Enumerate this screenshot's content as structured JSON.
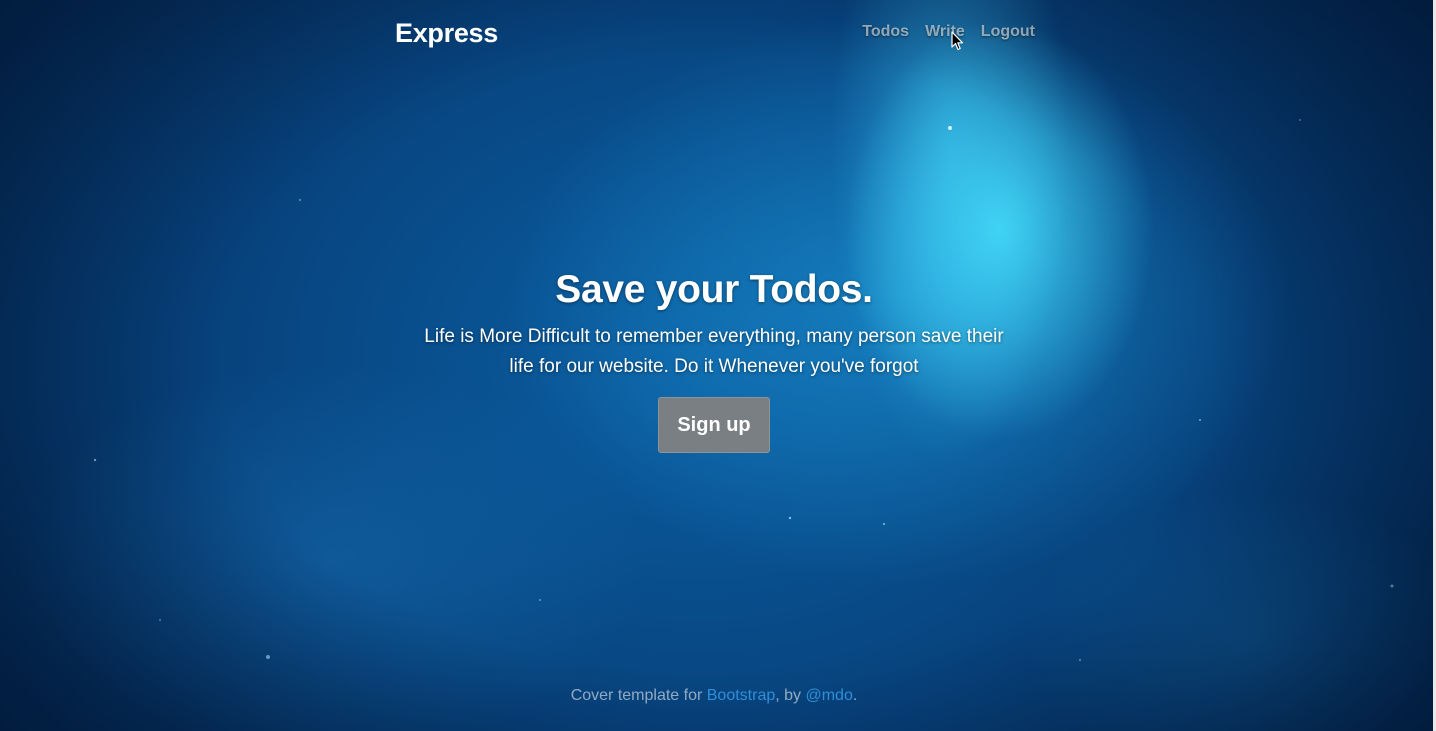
{
  "header": {
    "brand": "Express",
    "nav": [
      {
        "label": "Todos"
      },
      {
        "label": "Write"
      },
      {
        "label": "Logout"
      }
    ]
  },
  "cover": {
    "heading": "Save your Todos.",
    "lead_line1": "Life is More Difficult to remember everything, many person save their",
    "lead_line2": "life for our website. Do it Whenever you've forgot",
    "button_label": "Sign up"
  },
  "footer": {
    "prefix": "Cover template for ",
    "link1": "Bootstrap",
    "middle": ", by ",
    "link2": "@mdo",
    "suffix": "."
  },
  "colors": {
    "background": "#0b5fa3",
    "nebula_highlight": "#46e1ff",
    "button": "#7a7f83",
    "link": "#2d8fd8"
  },
  "icons": {
    "cursor": "mouse-pointer-icon"
  }
}
